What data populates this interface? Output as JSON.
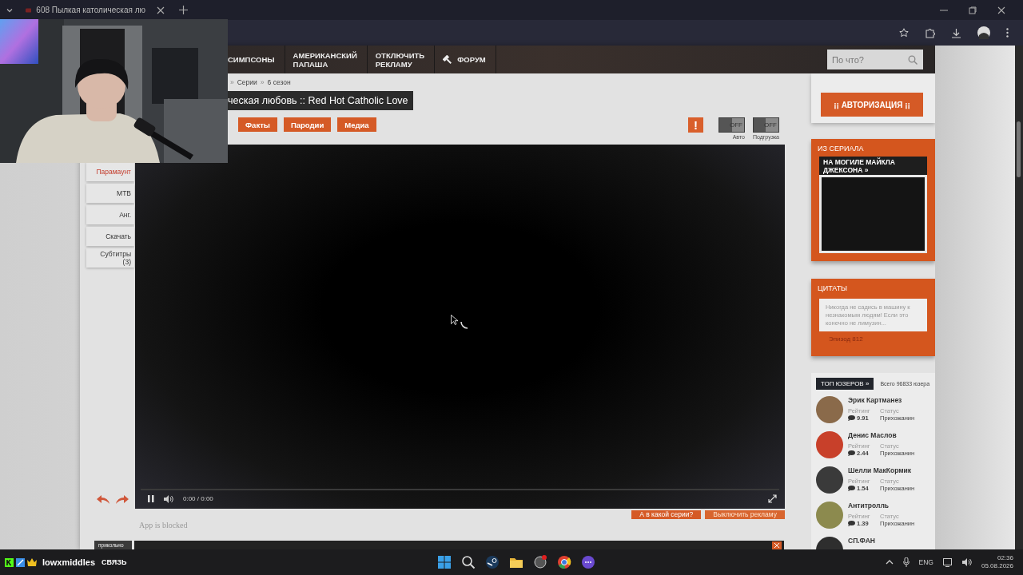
{
  "browser": {
    "tab": {
      "title": "608 Пылкая католическая лю"
    }
  },
  "site": {
    "nav": [
      {
        "label": "СИМПСОНЫ",
        "kind": "plain"
      },
      {
        "label": "АМЕРИКАНСКИЙ ПАПАША",
        "kind": "plain"
      },
      {
        "label": "ОТКЛЮЧИТЬ РЕКЛАМУ",
        "kind": "plain"
      },
      {
        "label": "ФОРУМ",
        "kind": "hammer"
      }
    ],
    "search": {
      "placeholder": "По что?"
    }
  },
  "breadcrumb": [
    {
      "text": "»",
      "kind": "separator"
    },
    {
      "text": "Серии",
      "kind": "link"
    },
    {
      "text": "»",
      "kind": "separator"
    },
    {
      "text": "6 сезон",
      "kind": "link"
    }
  ],
  "title": "ческая любовь :: Red Hot Catholic Love",
  "tabs": [
    "Факты",
    "Пародии",
    "Медиа"
  ],
  "alert": "!",
  "toggles": [
    {
      "state": "OFF",
      "label": "Авто",
      "on": false
    },
    {
      "state": "OFF",
      "label": "Подгрузка",
      "on": false
    }
  ],
  "versions": [
    {
      "label": "Парамаунт",
      "selected": true
    },
    {
      "label": "МТВ",
      "selected": false
    },
    {
      "label": "Анг.",
      "selected": false
    },
    {
      "label": "Скачать",
      "selected": false
    },
    {
      "label": "Субтитры (3)",
      "selected": false
    }
  ],
  "player": {
    "time": "0:00 / 0:00",
    "loading": true
  },
  "below": {
    "buttons": [
      {
        "label": "А в какой серии?",
        "kind": "primary"
      },
      {
        "label": "Выключить рекламу",
        "kind": "faded"
      }
    ],
    "notice": "App is blocked"
  },
  "bottom_bar": {
    "tag": "прикольно"
  },
  "sidebar": {
    "auth": "¡¡ АВТОРИЗАЦИЯ ¡¡",
    "from_series": {
      "heading": "ИЗ СЕРИАЛА",
      "episode": "НА МОГИЛЕ МАЙКЛА ДЖЕКСОНА »"
    },
    "quotes": {
      "heading": "ЦИТАТЫ",
      "quote": "Никогда не садись в машину к незнакомым людям! Если это конечно не лимузин...",
      "source": "Эпизод 812"
    },
    "top_users": {
      "heading": "ТОП ЮЗЕРОВ »",
      "total": "Всего 96833 юзера",
      "users": [
        {
          "name": "Эрик Картманез",
          "rating_label": "Рейтинг",
          "rating": "9.91",
          "status_label": "Статус",
          "status": "Прихожанин",
          "color": "#8a6a4a"
        },
        {
          "name": "Денис Маслов",
          "rating_label": "Рейтинг",
          "rating": "2.44",
          "status_label": "Статус",
          "status": "Прихожанин",
          "color": "#c8402a"
        },
        {
          "name": "Шелли МакКормик",
          "rating_label": "Рейтинг",
          "rating": "1.54",
          "status_label": "Статус",
          "status": "Прихожанин",
          "color": "#3a3a3a"
        },
        {
          "name": "Антитролль",
          "rating_label": "Рейтинг",
          "rating": "1.39",
          "status_label": "Статус",
          "status": "Прихожанин",
          "color": "#8c8a4e"
        },
        {
          "name": "СП.ФАН",
          "color": "#2e2e2e"
        }
      ]
    }
  },
  "taskbar": {
    "streamer": "lowxmiddles",
    "link": "СВЯЗЬ",
    "language": "ENG",
    "time": "02:36",
    "date": "05.08.2026"
  }
}
